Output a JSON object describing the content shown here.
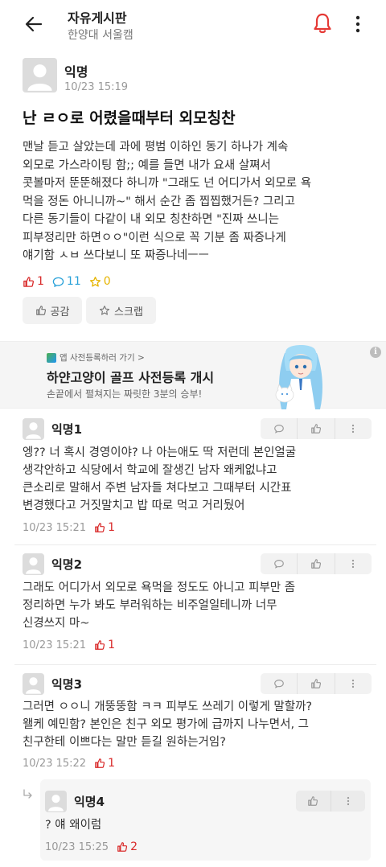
{
  "header": {
    "title": "자유게시판",
    "subtitle": "한양대 서울캠"
  },
  "post": {
    "author": "익명",
    "time": "10/23 15:19",
    "title": "난 ㄹㅇ로 어렸을때부터 외모칭찬",
    "body": "맨날 듣고 살았는데 과에 평범 이하인 동기 하나가 계속\n외모로 가스라이팅 함;; 예를 들면 내가 요새 살쪄서\n콧볼마저 뚠뚠해졌다 하니까 \"그래도 넌 어디가서 외모로 욕\n먹을 정돈 아니니까~\" 해서 순간 좀 찝찝했거든? 그리고\n다른 동기들이 다같이 내 외모 칭찬하면 \"진짜 쓰니는\n피부정리만 하면ㅇㅇ\"이런 식으로 꼭 기분 좀 짜증나게\n얘기함 ㅅㅂ 쓰다보니 또 짜증나네ㅡㅡ",
    "likes": "1",
    "comments": "11",
    "scraps": "0",
    "like_button": "공감",
    "scrap_button": "스크랩"
  },
  "ad": {
    "small_label": "앱 사전등록하러 가기 >",
    "title": "하얀고양이 골프 사전등록 개시",
    "description": "손끝에서 펼쳐지는 짜릿한 3분의 승부!",
    "info": "i"
  },
  "comments": [
    {
      "author": "익명1",
      "body": "엥?? 너 혹시 경영이야? 나 아는애도 딱 저런데 본인얼굴\n생각안하고 식당에서 학교에 잘생긴 남자 왜케없냐고\n큰소리로 말해서 주변 남자들 쳐다보고 그때부터 시간표\n변경했다고 거짓말치고 밥 따로 먹고 거리뒀어",
      "time": "10/23 15:21",
      "likes": "1"
    },
    {
      "author": "익명2",
      "body": "그래도 어디가서 외모로 욕먹을 정도도 아니고 피부만 좀\n정리하면 누가 봐도 부러워하는 비주얼일테니까 너무\n신경쓰지 마~",
      "time": "10/23 15:21",
      "likes": "1"
    },
    {
      "author": "익명3",
      "body": "그러면 ㅇㅇ니 개뚱뚱함 ㅋㅋ 피부도 쓰레기 이렇게 말할까?\n왤케 예민함? 본인은 친구 외모 평가에 급까지 나누면서, 그\n친구한테 이쁘다는 말만 듣길 원하는거임?",
      "time": "10/23 15:22",
      "likes": "1"
    }
  ],
  "reply": {
    "author": "익명4",
    "body": "? 얘 왜이럼",
    "time": "10/23 15:25",
    "likes": "2"
  },
  "colors": {
    "like": "#d92b2b",
    "comment": "#2ba2d9",
    "scrap": "#e6b400",
    "bell": "#e53935"
  }
}
